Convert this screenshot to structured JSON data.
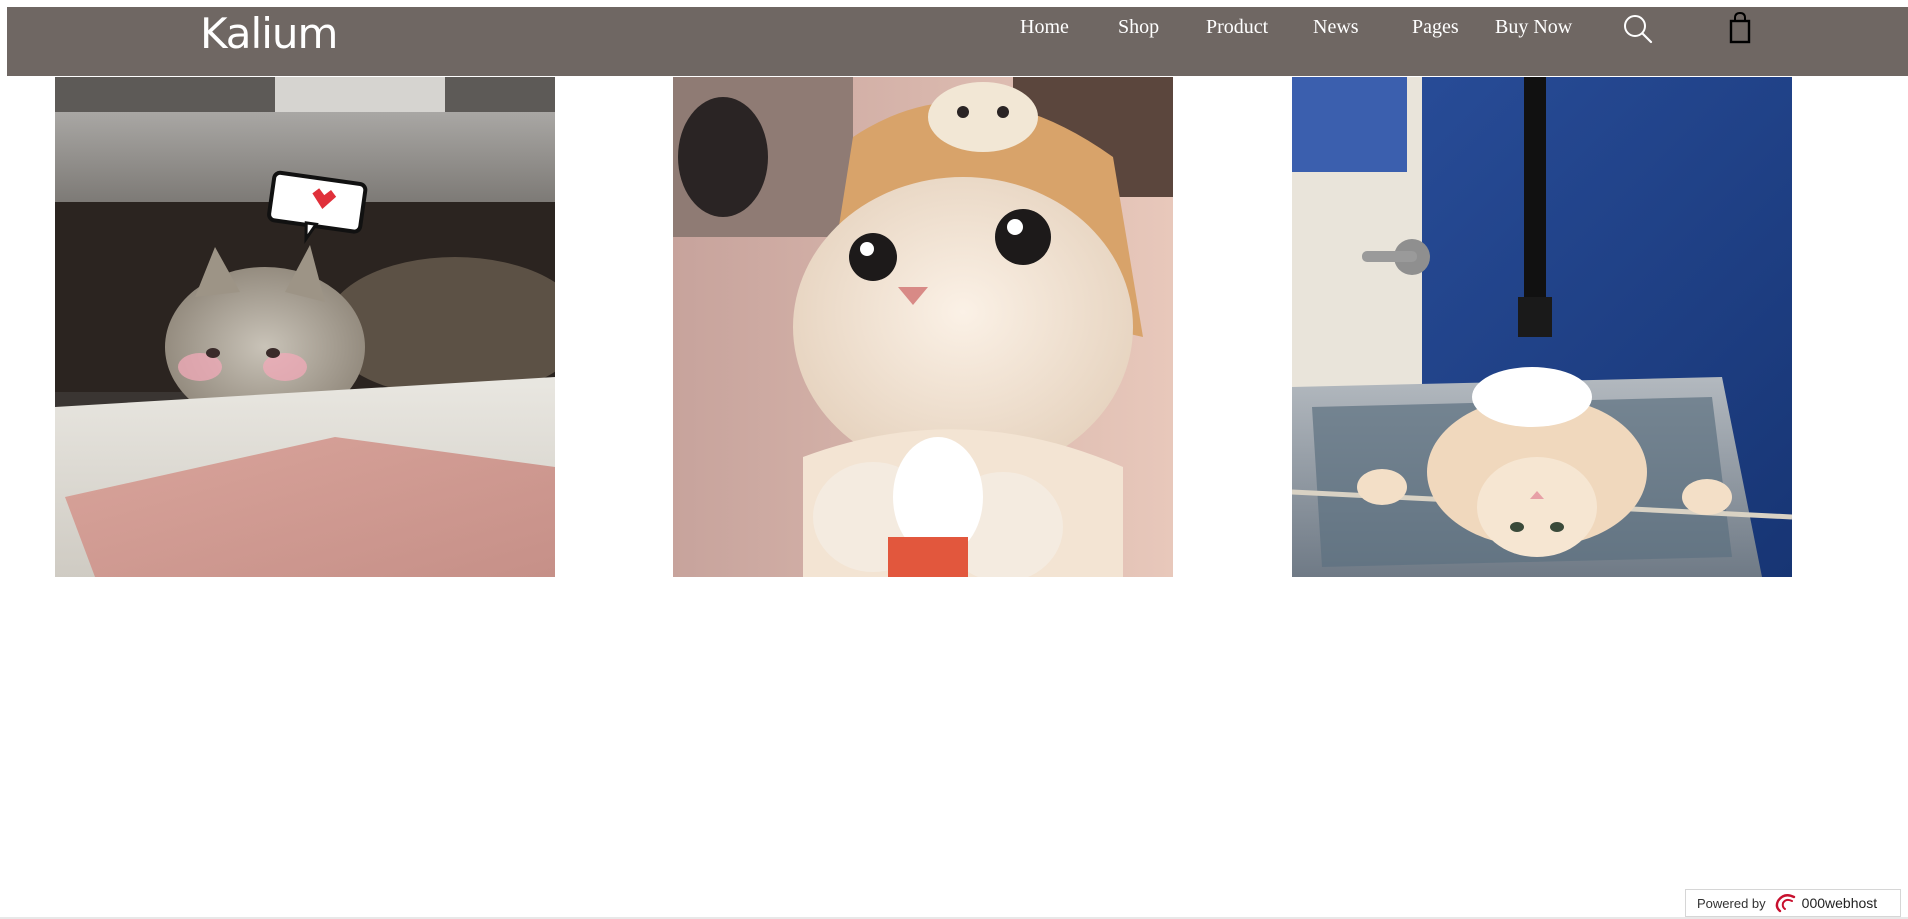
{
  "header": {
    "logo": "Kalium",
    "nav": {
      "home": "Home",
      "shop": "Shop",
      "product": "Product",
      "news": "News",
      "pages": "Pages",
      "buy_now": "Buy Now"
    },
    "icons": {
      "search": "search-icon",
      "cart": "shopping-bag-icon"
    },
    "background_color": "#6f6763"
  },
  "gallery": {
    "images": [
      {
        "name": "kitten-on-table-photo"
      },
      {
        "name": "cat-in-bear-hat-photo"
      },
      {
        "name": "cat-upside-down-photo"
      }
    ]
  },
  "footer_badge": {
    "label": "Powered by",
    "brand": "000webhost"
  }
}
